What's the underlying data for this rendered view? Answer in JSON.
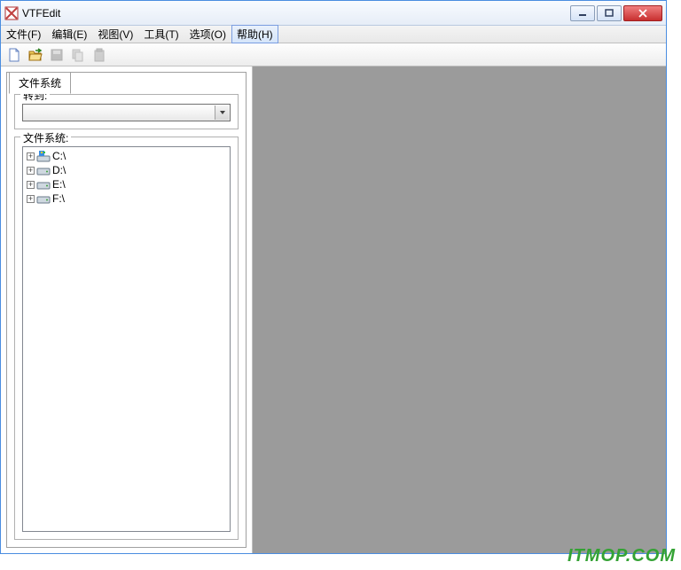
{
  "title": "VTFEdit",
  "menus": {
    "file": "文件(F)",
    "edit": "编辑(E)",
    "view": "视图(V)",
    "tools": "工具(T)",
    "options": "选项(O)",
    "help": "帮助(H)"
  },
  "tabs": {
    "filesystem": "文件系统"
  },
  "groups": {
    "goto": "转到:",
    "filesystem": "文件系统:"
  },
  "drives": [
    {
      "label": "C:\\",
      "type": "system"
    },
    {
      "label": "D:\\",
      "type": "disk"
    },
    {
      "label": "E:\\",
      "type": "disk"
    },
    {
      "label": "F:\\",
      "type": "disk"
    }
  ],
  "watermark": "ITMOP.COM"
}
